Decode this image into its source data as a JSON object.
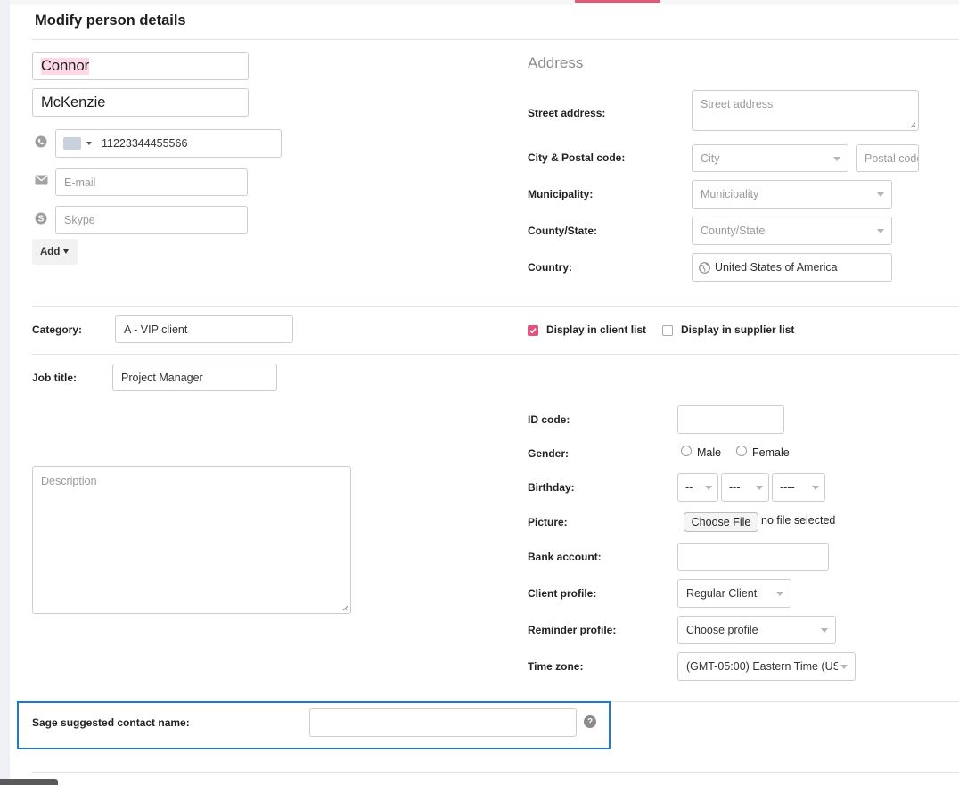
{
  "header": {
    "title": "Modify person details"
  },
  "person": {
    "first_name": "Connor",
    "last_name": "McKenzie",
    "phone": "11223344455566",
    "email_placeholder": "E-mail",
    "skype_placeholder": "Skype",
    "add_label": "Add"
  },
  "address": {
    "section_title": "Address",
    "street_label": "Street address:",
    "street_placeholder": "Street address",
    "city_label": "City & Postal code:",
    "city_placeholder": "City",
    "postal_placeholder": "Postal code",
    "municipality_label": "Municipality:",
    "municipality_placeholder": "Municipality",
    "county_label": "County/State:",
    "county_placeholder": "County/State",
    "country_label": "Country:",
    "country_value": "United States of America"
  },
  "classification": {
    "category_label": "Category:",
    "category_value": "A - VIP client",
    "client_list_label": "Display in client list",
    "client_list_checked": true,
    "supplier_list_label": "Display in supplier list",
    "supplier_list_checked": false
  },
  "job": {
    "job_title_label": "Job title:",
    "job_title_value": "Project Manager",
    "description_placeholder": "Description"
  },
  "details": {
    "id_code_label": "ID code:",
    "gender_label": "Gender:",
    "gender_male": "Male",
    "gender_female": "Female",
    "birthday_label": "Birthday:",
    "birthday_day": "--",
    "birthday_month": "---",
    "birthday_year": "----",
    "picture_label": "Picture:",
    "choose_file_label": "Choose File",
    "no_file_text": "no file selected",
    "bank_account_label": "Bank account:",
    "client_profile_label": "Client profile:",
    "client_profile_value": "Regular Client",
    "reminder_profile_label": "Reminder profile:",
    "reminder_profile_value": "Choose profile",
    "time_zone_label": "Time zone:",
    "time_zone_value": "(GMT-05:00) Eastern Time (US"
  },
  "sage": {
    "label": "Sage suggested contact name:",
    "help_icon": "?"
  },
  "colors": {
    "accent": "#e0557e",
    "highlight_border": "#1a7bd6"
  }
}
